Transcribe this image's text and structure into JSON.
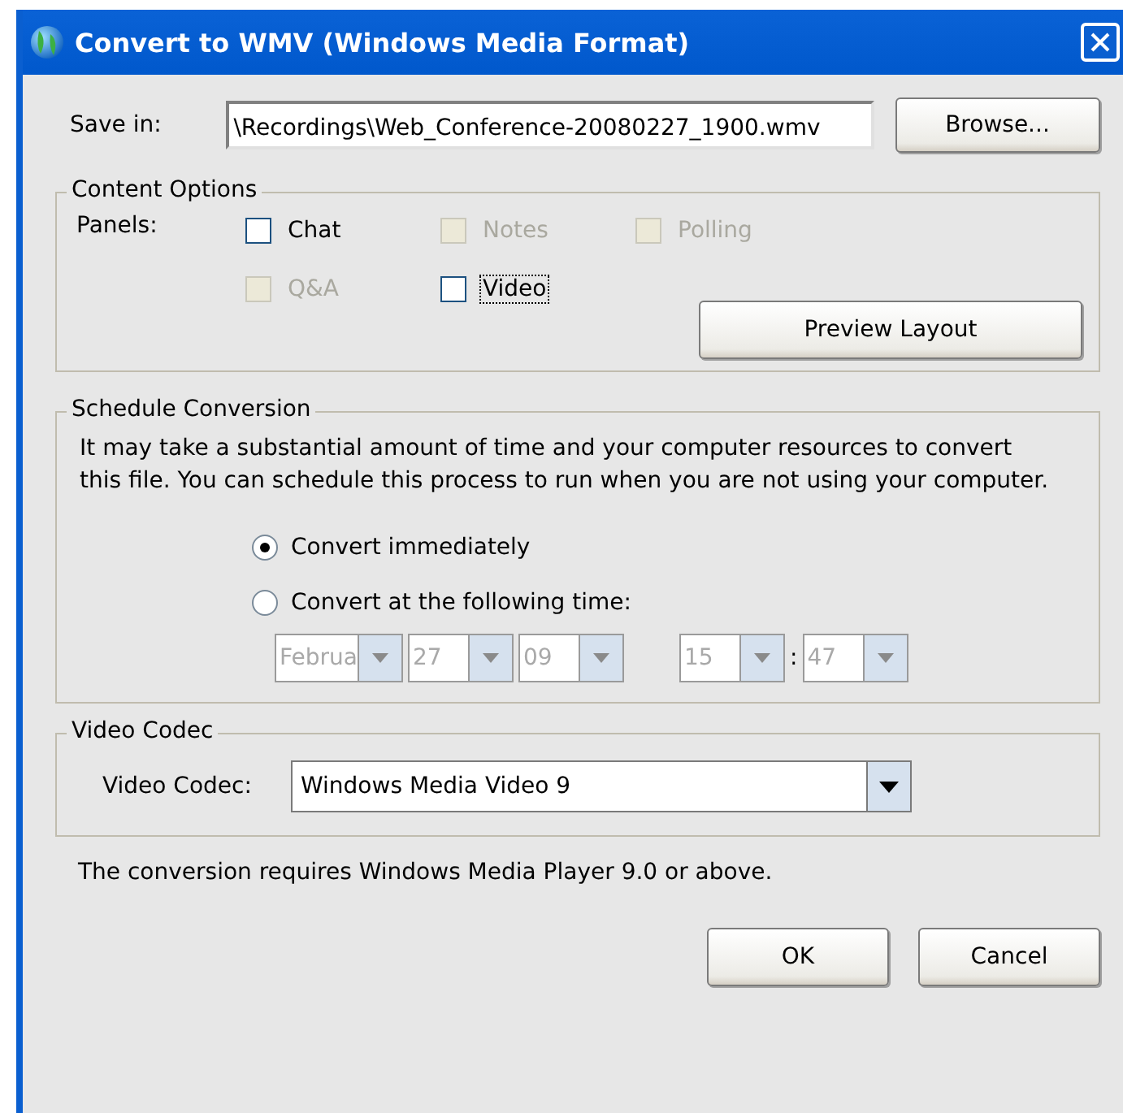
{
  "window": {
    "title": "Convert to WMV (Windows Media Format)"
  },
  "save_in": {
    "label": "Save in:",
    "value": "\\Recordings\\Web_Conference-20080227_1900.wmv",
    "button": "Browse..."
  },
  "content_options": {
    "title": "Content Options",
    "panels_label": "Panels:",
    "panels": [
      {
        "label": "Chat",
        "checked": false,
        "disabled": false,
        "focused": false
      },
      {
        "label": "Notes",
        "checked": false,
        "disabled": true,
        "focused": false
      },
      {
        "label": "Polling",
        "checked": false,
        "disabled": true,
        "focused": false
      },
      {
        "label": "Q&A",
        "checked": false,
        "disabled": true,
        "focused": false
      },
      {
        "label": "Video",
        "checked": false,
        "disabled": false,
        "focused": true
      }
    ],
    "button": "Preview Layout"
  },
  "schedule": {
    "title": "Schedule Conversion",
    "description": "It may take a substantial amount of time and your computer resources to convert this file. You can schedule this process to run when you are not using your computer.",
    "options": [
      {
        "label": "Convert immediately",
        "selected": true
      },
      {
        "label": "Convert at the following time:",
        "selected": false
      }
    ],
    "date_fields": [
      {
        "value": "Februa",
        "disabled": true
      },
      {
        "value": "27",
        "disabled": true
      },
      {
        "value": "09",
        "disabled": true
      }
    ],
    "time_fields": [
      {
        "value": "15",
        "disabled": true
      },
      {
        "value": "47",
        "disabled": true
      }
    ],
    "time_separator": ":"
  },
  "video_codec": {
    "title": "Video Codec",
    "label": "Video Codec:",
    "value": "Windows Media Video 9"
  },
  "note": "The conversion requires Windows Media Player 9.0 or above.",
  "buttons": [
    "OK",
    "Cancel"
  ]
}
